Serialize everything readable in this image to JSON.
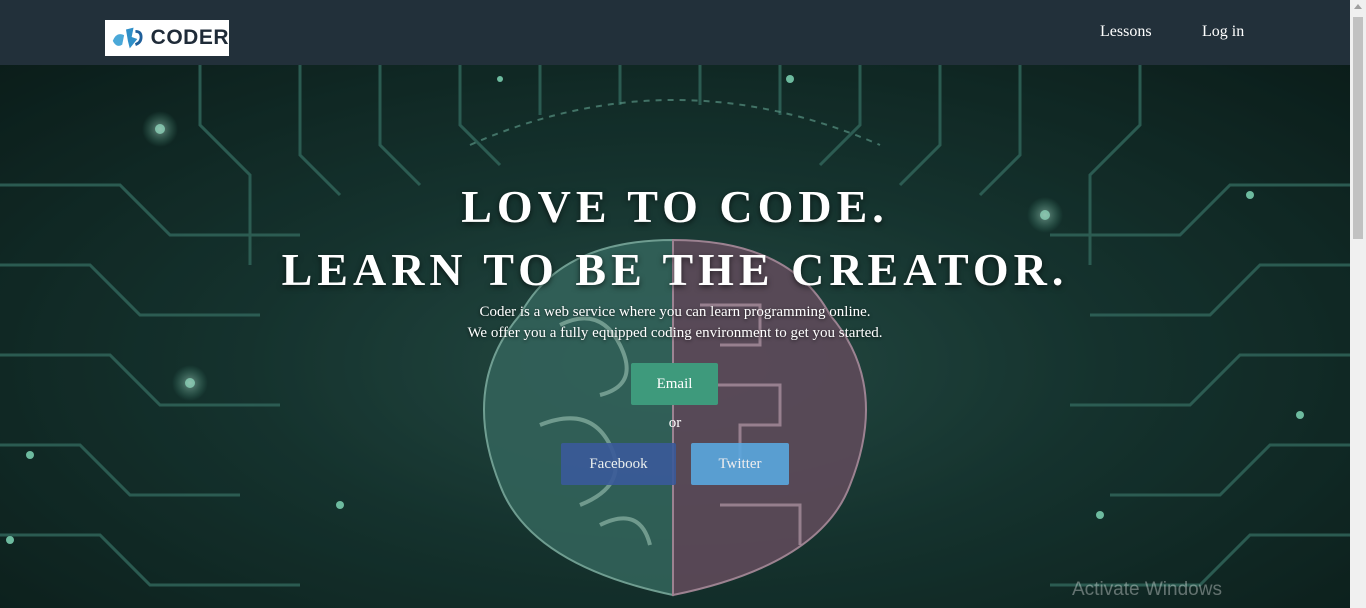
{
  "brand": {
    "name": "CODER"
  },
  "nav": {
    "lessons": "Lessons",
    "login": "Log in"
  },
  "hero": {
    "headline_1": "LOVE TO CODE.",
    "headline_2": "LEARN TO BE THE CREATOR.",
    "sub_1": "Coder is a web service where you can learn programming online.",
    "sub_2": "We offer you a fully equipped coding environment to get you started.",
    "email_button": "Email",
    "or": "or",
    "facebook_button": "Facebook",
    "twitter_button": "Twitter"
  },
  "watermark": "Activate Windows",
  "colors": {
    "navbar": "#22303a",
    "email": "#3e9a7c",
    "facebook": "#3a5a9a",
    "twitter": "#5aa8df"
  },
  "icons": {
    "logo": "coder-logo-icon",
    "scroll_up": "scroll-up-arrow-icon"
  }
}
